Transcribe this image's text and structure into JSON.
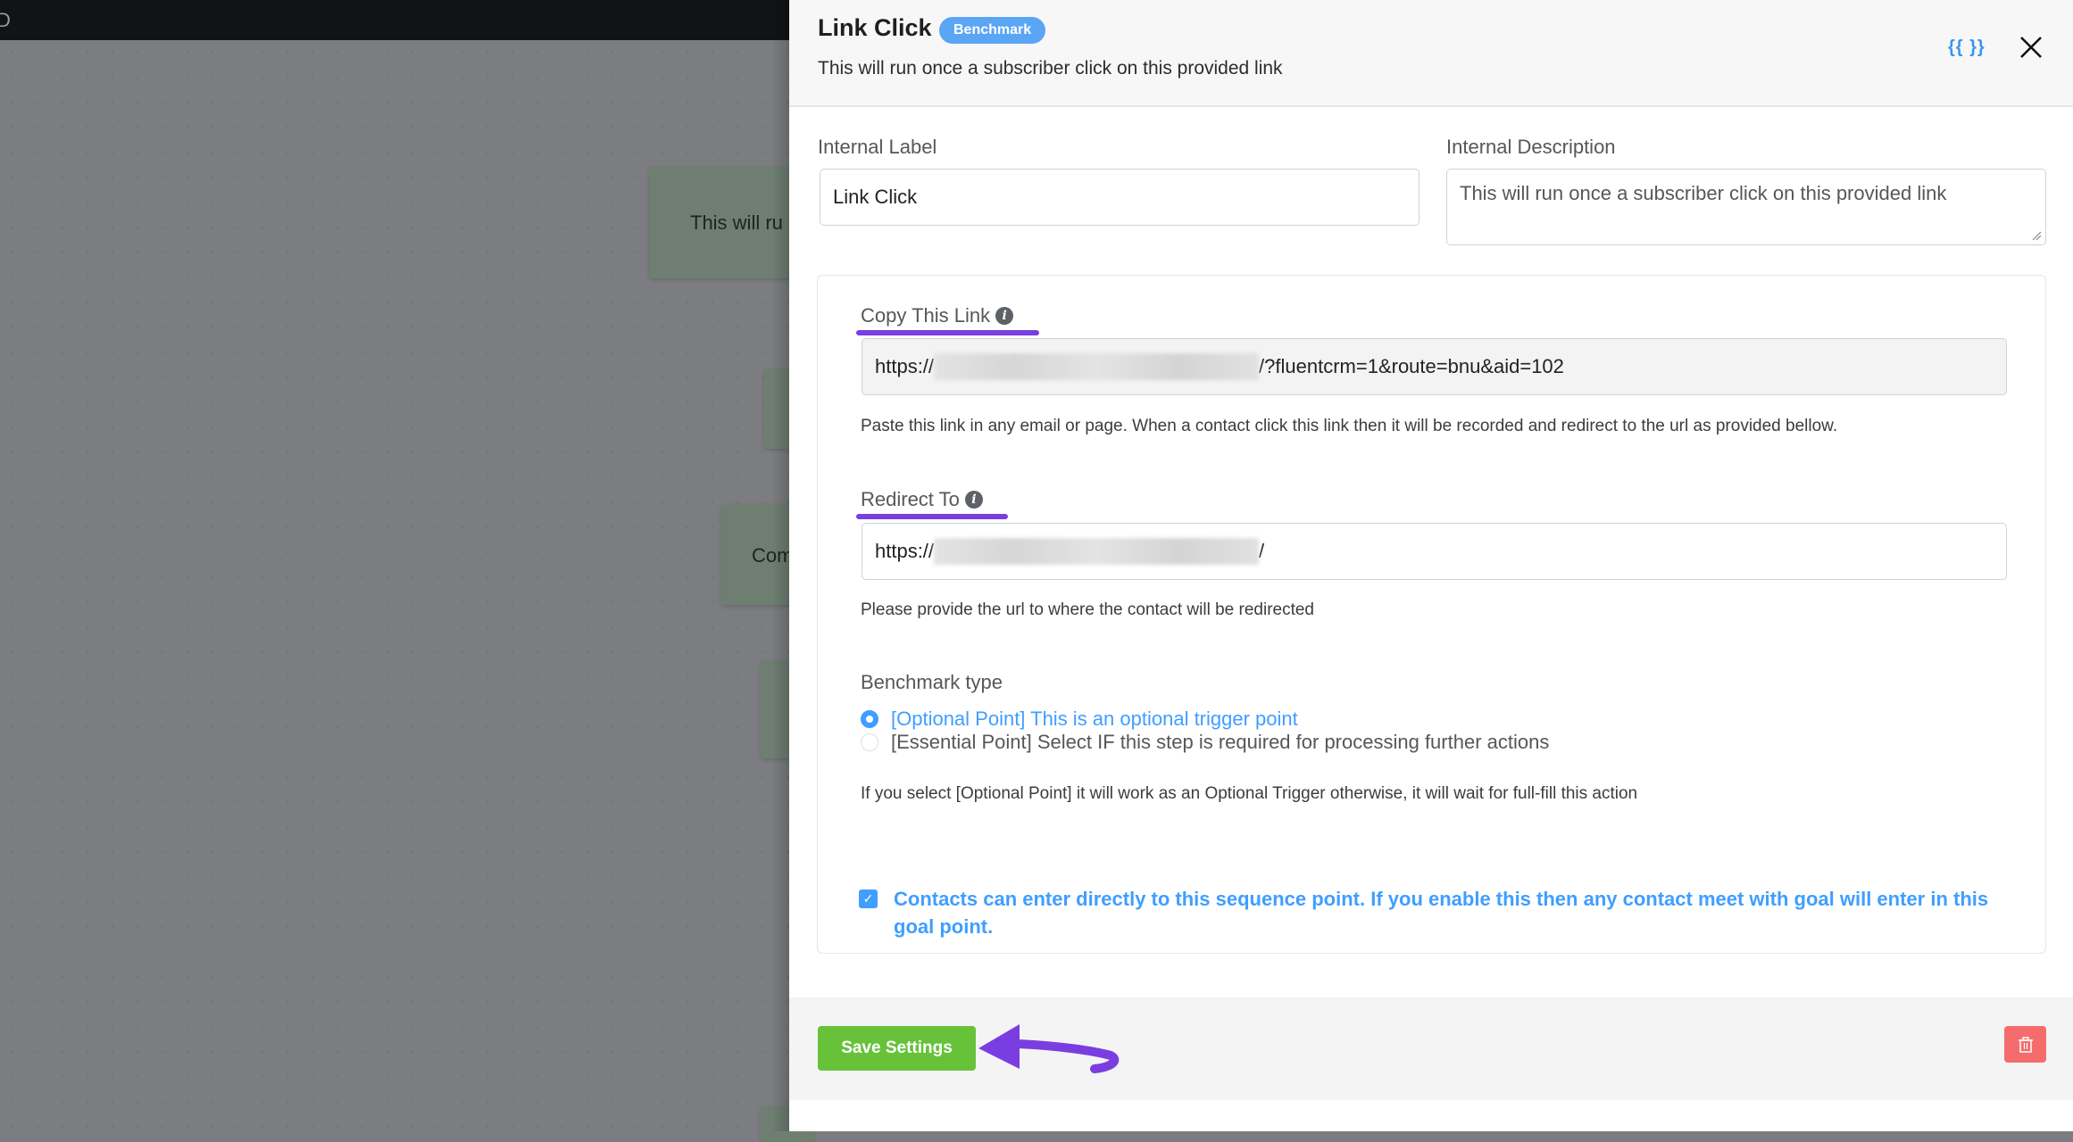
{
  "background": {
    "topbar_text": "D",
    "nodes": [
      {
        "text": "This will ru"
      },
      {
        "text": "Com"
      }
    ]
  },
  "header": {
    "title": "Link Click",
    "badge": "Benchmark",
    "subtitle": "This will run once a subscriber click on this provided link",
    "smartcode_icon_label": "{{ }}"
  },
  "form": {
    "internal_label": {
      "label": "Internal Label",
      "value": "Link Click"
    },
    "internal_description": {
      "label": "Internal Description",
      "value": "This will run once a subscriber click on this provided link"
    },
    "copy_link": {
      "label": "Copy This Link",
      "value_prefix": "https://",
      "value_suffix": "/?fluentcrm=1&route=bnu&aid=102",
      "help": "Paste this link in any email or page. When a contact click this link then it will be recorded and redirect to the url as provided bellow."
    },
    "redirect_to": {
      "label": "Redirect To",
      "value_prefix": "https://",
      "value_suffix": "/",
      "help": "Please provide the url to where the contact will be redirected"
    },
    "benchmark_type": {
      "label": "Benchmark type",
      "options": [
        {
          "label": "[Optional Point] This is an optional trigger point",
          "selected": true
        },
        {
          "label": "[Essential Point] Select IF this step is required for processing further actions",
          "selected": false
        }
      ],
      "help": "If you select [Optional Point] it will work as an Optional Trigger otherwise, it will wait for full-fill this action"
    },
    "direct_entry": {
      "checked": true,
      "label": "Contacts can enter directly to this sequence point. If you enable this then any contact meet with goal will enter in this goal point."
    }
  },
  "footer": {
    "save_label": "Save Settings"
  },
  "colors": {
    "primary": "#409eff",
    "success": "#67c23a",
    "danger": "#f56c6c",
    "annotation": "#7a3ee0",
    "badge": "#5aa6f5"
  }
}
